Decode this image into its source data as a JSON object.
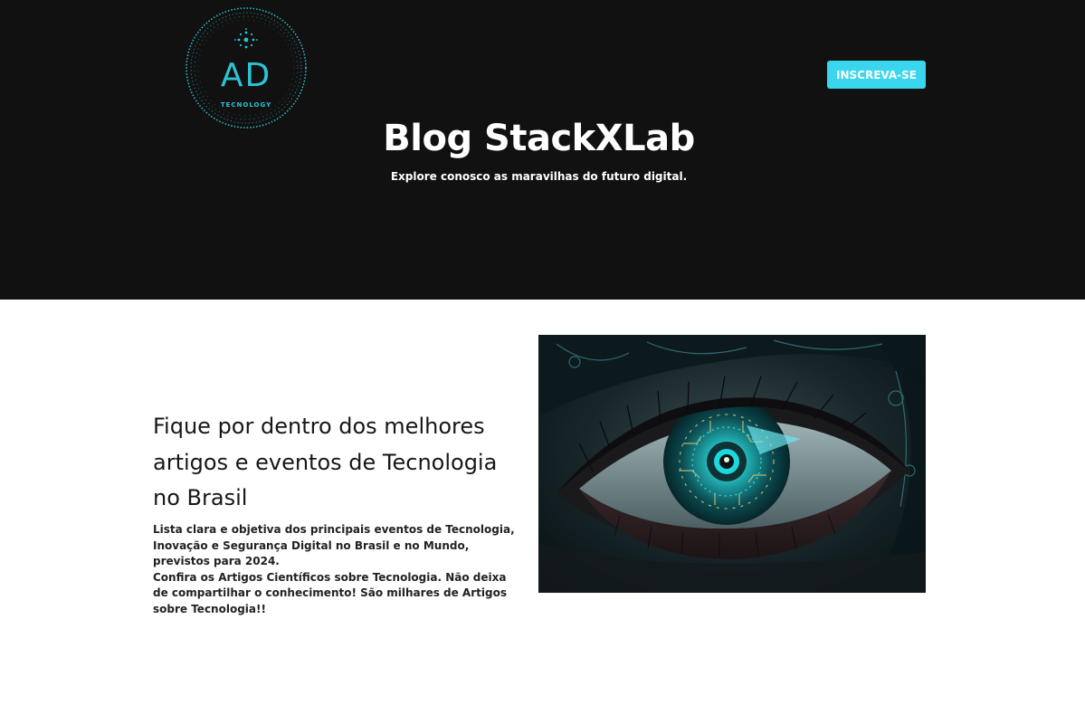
{
  "header": {
    "logo": {
      "mark": "AD",
      "tagline": "TECNOLOGY"
    },
    "subscribe_label": "INSCREVA-SE",
    "title": "Blog StackXLab",
    "subtitle": "Explore conosco as maravilhas do futuro digital."
  },
  "main": {
    "heading": "Fique por dentro dos melhores artigos e eventos de Tecnologia no Brasil",
    "paragraphs": [
      "Lista clara e objetiva dos principais eventos de Tecnologia, Inovação e Segurança Digital no Brasil e no Mundo, previstos para 2024.",
      "Confira os Artigos Científicos sobre Tecnologia. Não deixa de compartilhar o conhecimento! São milhares de Artigos sobre Tecnologia!!"
    ],
    "image": {
      "icon": "cyber-eye-image"
    }
  },
  "colors": {
    "hero_background": "#121112",
    "accent": "#3ad6ee",
    "logo_teal": "#2bc4d3"
  }
}
